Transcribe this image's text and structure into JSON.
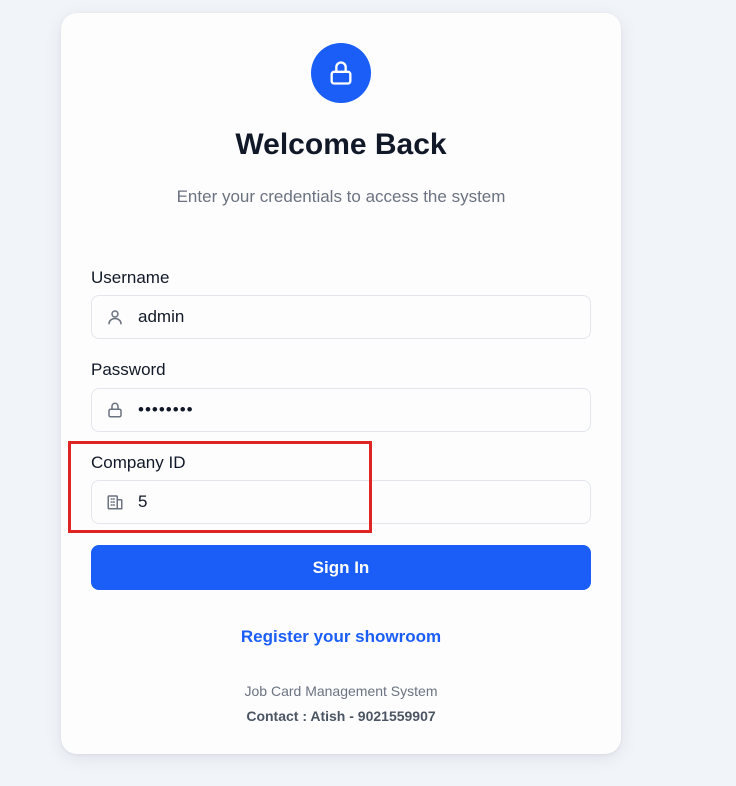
{
  "header": {
    "title": "Welcome Back",
    "subtitle": "Enter your credentials to access the system"
  },
  "form": {
    "username": {
      "label": "Username",
      "value": "admin",
      "icon": "user-icon"
    },
    "password": {
      "label": "Password",
      "value": "••••••••",
      "icon": "lock-icon"
    },
    "company_id": {
      "label": "Company ID",
      "value": "5",
      "icon": "building-icon"
    },
    "submit_label": "Sign In"
  },
  "links": {
    "register": "Register your showroom"
  },
  "footer": {
    "system_name": "Job Card Management System",
    "contact": "Contact : Atish - 9021559907"
  },
  "colors": {
    "primary": "#1a5ef7",
    "background": "#f1f4f9",
    "card": "#fdfdfe",
    "highlight": "#e02424"
  }
}
